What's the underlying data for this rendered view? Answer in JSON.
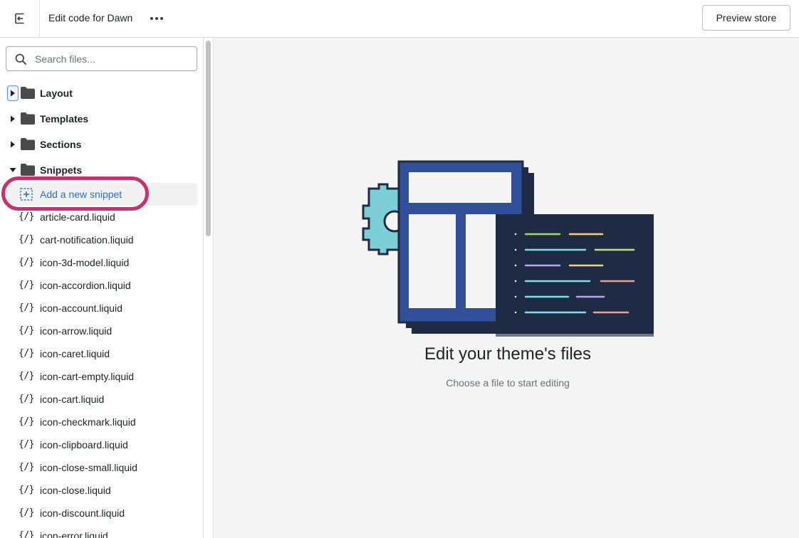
{
  "topbar": {
    "title": "Edit code for Dawn",
    "preview_label": "Preview store"
  },
  "sidebar": {
    "search_placeholder": "Search files...",
    "folders": [
      {
        "label": "Layout",
        "expanded": false
      },
      {
        "label": "Templates",
        "expanded": false
      },
      {
        "label": "Sections",
        "expanded": false
      },
      {
        "label": "Snippets",
        "expanded": true
      }
    ],
    "add_snippet_label": "Add a new snippet",
    "code_glyph": "{/}",
    "files": [
      "article-card.liquid",
      "cart-notification.liquid",
      "icon-3d-model.liquid",
      "icon-accordion.liquid",
      "icon-account.liquid",
      "icon-arrow.liquid",
      "icon-caret.liquid",
      "icon-cart-empty.liquid",
      "icon-cart.liquid",
      "icon-checkmark.liquid",
      "icon-clipboard.liquid",
      "icon-close-small.liquid",
      "icon-close.liquid",
      "icon-discount.liquid",
      "icon-error.liquid"
    ]
  },
  "main": {
    "title": "Edit your theme's files",
    "subtitle": "Choose a file to start editing"
  },
  "colors": {
    "link": "#2c6ecb",
    "highlight": "#c8306e",
    "folder": "#4a4a4a",
    "illustration_navy": "#1f2a44",
    "illustration_blue": "#32509a",
    "illustration_cyan": "#7ccfd6"
  },
  "icons": {
    "exit": "exit-icon",
    "more": "more-horizontal-icon",
    "search": "search-icon",
    "caret_right": "caret-right-icon",
    "caret_down": "caret-down-icon",
    "folder": "folder-icon",
    "add": "add-file-icon",
    "code": "code-file-icon"
  }
}
